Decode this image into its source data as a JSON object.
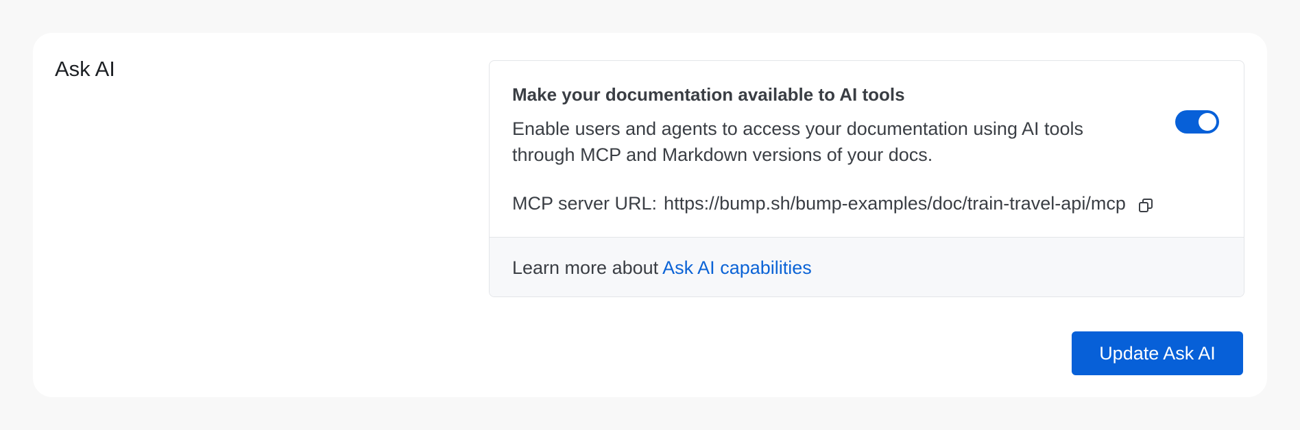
{
  "section": {
    "title": "Ask AI"
  },
  "panel": {
    "heading": "Make your documentation available to AI tools",
    "description": "Enable users and agents to access your documentation using AI tools through MCP and Markdown versions of your docs.",
    "toggle": {
      "enabled": true,
      "color": "#0760d8"
    },
    "mcp": {
      "label": "MCP server URL:",
      "url": "https://bump.sh/bump-examples/doc/train-travel-api/mcp",
      "copy_icon": "copy-icon"
    },
    "footer": {
      "prefix": "Learn more about",
      "link_text": "Ask AI capabilities"
    }
  },
  "actions": {
    "update_label": "Update Ask AI"
  },
  "colors": {
    "accent": "#0760d8",
    "link": "#0b63d6",
    "background": "#f8f8f8"
  }
}
